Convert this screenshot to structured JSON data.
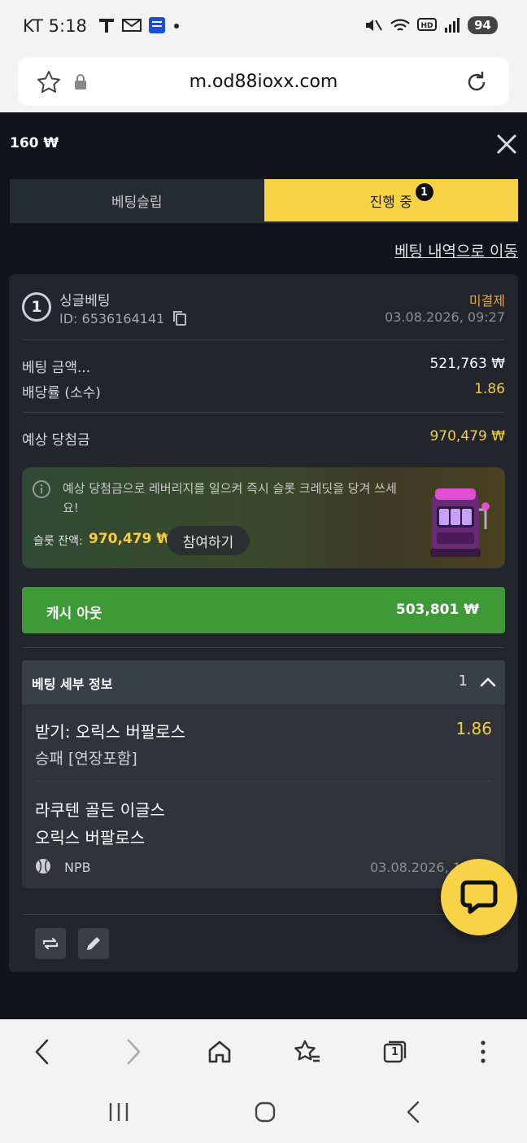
{
  "status_bar": {
    "carrier_time": "KT 5:18",
    "battery": "94"
  },
  "browser": {
    "url": "m.od88ioxx.com",
    "tab_count": "1"
  },
  "page": {
    "balance": "160 ₩",
    "tabs": [
      {
        "label": "베팅슬립"
      },
      {
        "label": "진행 중",
        "badge": "1"
      }
    ],
    "history_link": "베팅 내역으로 이동",
    "bet": {
      "number": "1",
      "type": "싱글베팅",
      "id": "ID: 6536164141",
      "status": "미결제",
      "date": "03.08.2026, 09:27",
      "stake_label": "베팅 금액...",
      "stake_value": "521,763 ₩",
      "odds_label": "배당률 (소수)",
      "odds_value": "1.86",
      "potential_label": "예상 당첨금",
      "potential_value": "970,479 ₩"
    },
    "promo": {
      "text": "예상 당첨금으로 레버리지를 일으켜 즉시 슬롯 크레딧을 당겨 쓰세요!",
      "slot_label": "슬롯 잔액:",
      "slot_amount": "970,479 ₩",
      "join_button": "참여하기"
    },
    "cashout": {
      "label": "캐시 아웃",
      "amount": "503,801 ₩"
    },
    "details": {
      "title": "베팅 세부 정보",
      "count": "1",
      "pick": "받기: 오릭스 버팔로스",
      "pick_odds": "1.86",
      "market": "승패 [연장포함]",
      "team_home": "라쿠텐 골든 이글스",
      "team_away": "오릭스 버팔로스",
      "league": "NPB",
      "match_date": "03.08.2026, 1"
    }
  },
  "colors": {
    "accent_yellow": "#f8d347",
    "cashout_green": "#3e9a36",
    "pending_orange": "#e0a640",
    "page_bg": "#11151b"
  }
}
